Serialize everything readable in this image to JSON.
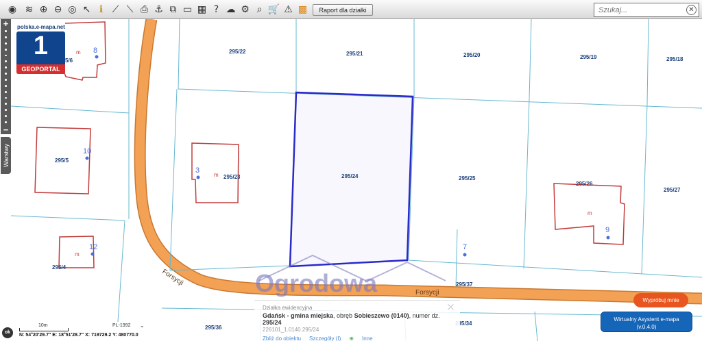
{
  "toolbar": {
    "icons": [
      "map-logo-icon",
      "layers-icon",
      "zoom-in-icon",
      "zoom-out-icon",
      "full-extent-icon",
      "pointer-icon",
      "info-icon",
      "measure-distance-icon",
      "measure-area-icon",
      "print-icon",
      "anchor-icon",
      "copy-icon",
      "window-icon",
      "grid-icon",
      "help-icon",
      "upload-icon",
      "settings-icon",
      "search-map-icon",
      "cart-icon",
      "warning-icon",
      "color-palette-icon"
    ],
    "report_label": "Raport dla działki"
  },
  "search": {
    "placeholder": "Szukaj..."
  },
  "logo": {
    "url": "polska.e-mapa.net",
    "number": "1",
    "brand": "GEOPORTAL"
  },
  "layers_label": "Warstwy",
  "parcels": {
    "p1": "295/22",
    "p2": "295/21",
    "p3": "295/20",
    "p4": "295/19",
    "p5": "295/18",
    "p6": "295/5",
    "p7": "295/23",
    "p8": "295/24",
    "p9": "295/25",
    "p10": "295/26",
    "p11": "295/27",
    "p12": "295/4",
    "p13": "295/37",
    "p14": "295/36",
    "p15": "295/34",
    "p16": "5/6"
  },
  "building_marker": "m",
  "house_numbers": {
    "h1": "8",
    "h2": "10",
    "h3": "3",
    "h4": "12",
    "h5": "9",
    "h6": "7"
  },
  "streets": {
    "s1": "Forsycji",
    "s2": "Forsycji"
  },
  "watermark": "Ogrodowa",
  "info": {
    "heading": "Działka ewidencyjna",
    "line_bold1": "Gdańsk - gmina miejska",
    "line_mid": ", obręb ",
    "line_bold2": "Sobieszewo (0140)",
    "line_mid2": ", numer dz. ",
    "line_bold3": "295/24",
    "parcel_id": "226101_1.0140.295/24",
    "link_zoom": "Zbliż do obiektu",
    "link_details": "Szczegóły (I)",
    "link_other": "Inne"
  },
  "status": {
    "ok": "ok",
    "scale": "10m",
    "crs": "PL-1992",
    "coords": "N: 54°20'29.7\"  E: 18°51'28.7\"  X: 719729.2  Y: 480770.0"
  },
  "buttons": {
    "try": "Wypróbuj mnie",
    "assistant_line1": "Wirtualny Asystent e-mapa",
    "assistant_line2": "(v.0.4.0)"
  },
  "colors": {
    "parcel_line": "#66b8d0",
    "building": "#c23b3b",
    "selected": "#2a2ac8",
    "road": "#f09a4a",
    "label": "#1b3f7a",
    "accent": "#e8551e"
  }
}
